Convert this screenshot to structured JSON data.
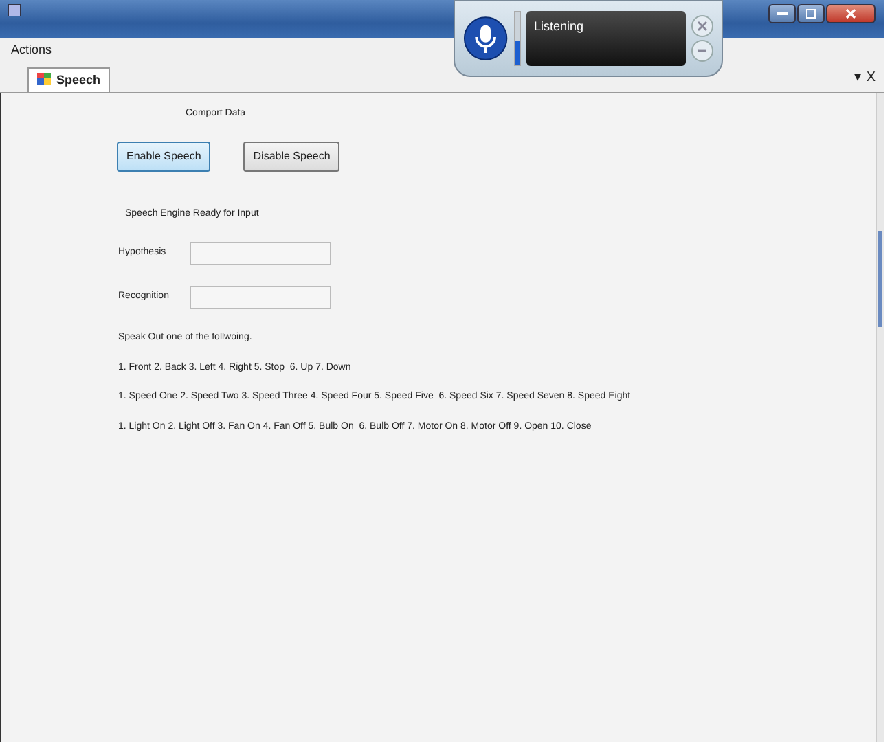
{
  "menu": [
    "Actions"
  ],
  "tabs": [
    {
      "label": "Speech",
      "selected": true
    }
  ],
  "tab_controls": [
    "▾",
    "X"
  ],
  "speech_widget": {
    "status": "Listening",
    "level": 0.45
  },
  "form": {
    "heading": "Comport Data",
    "buttons": [
      {
        "label": "Enable Speech",
        "highlighted": true
      },
      {
        "label": "Disable Speech",
        "highlighted": false
      }
    ],
    "status": "Speech Engine Ready for Input",
    "fields": [
      {
        "label": "Hypothesis"
      },
      {
        "label": "Recognition"
      }
    ],
    "instructions": "Speak Out one of the follwoing.",
    "command_lines": [
      "1. Front 2. Back 3. Left 4. Right 5. Stop  6. Up 7. Down",
      "1. Speed One 2. Speed Two 3. Speed Three 4. Speed Four 5. Speed Five  6. Speed Six 7. Speed Seven 8. Speed Eight",
      "1. Light On 2. Light Off 3. Fan On 4. Fan Off 5. Bulb On  6. Bulb Off 7. Motor On 8. Motor Off 9. Open 10. Close"
    ]
  }
}
